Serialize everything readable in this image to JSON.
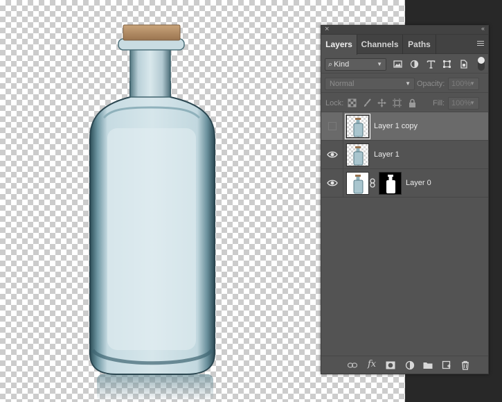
{
  "panel": {
    "close_glyph": "×",
    "collapse_glyph": "‹‹",
    "tabs": [
      {
        "label": "Layers",
        "active": true
      },
      {
        "label": "Channels",
        "active": false
      },
      {
        "label": "Paths",
        "active": false
      }
    ],
    "filter": {
      "kind_label": "Kind",
      "icons": [
        "pixel-filter-icon",
        "adjustment-filter-icon",
        "type-filter-icon",
        "shape-filter-icon",
        "smart-object-filter-icon"
      ]
    },
    "blend": {
      "mode": "Normal",
      "opacity_label": "Opacity:",
      "opacity_value": "100%"
    },
    "lock": {
      "label": "Lock:",
      "icons": [
        "lock-transparent-icon",
        "lock-image-icon",
        "lock-position-icon",
        "lock-artboard-icon",
        "lock-all-icon"
      ],
      "fill_label": "Fill:",
      "fill_value": "100%"
    },
    "layers": [
      {
        "name": "Layer 1 copy",
        "visible": false,
        "selected": true
      },
      {
        "name": "Layer 1",
        "visible": true,
        "selected": false
      },
      {
        "name": "Layer 0",
        "visible": true,
        "selected": false,
        "has_mask": true
      }
    ],
    "bottom_icons": [
      "link-layers-icon",
      "layer-style-icon",
      "add-mask-icon",
      "adjustment-layer-icon",
      "new-group-icon",
      "new-layer-icon",
      "delete-layer-icon"
    ],
    "fx_label": "fx"
  },
  "colors": {
    "panel_bg": "#535353",
    "selected_row": "#6a6a6a",
    "workspace": "#282828"
  }
}
